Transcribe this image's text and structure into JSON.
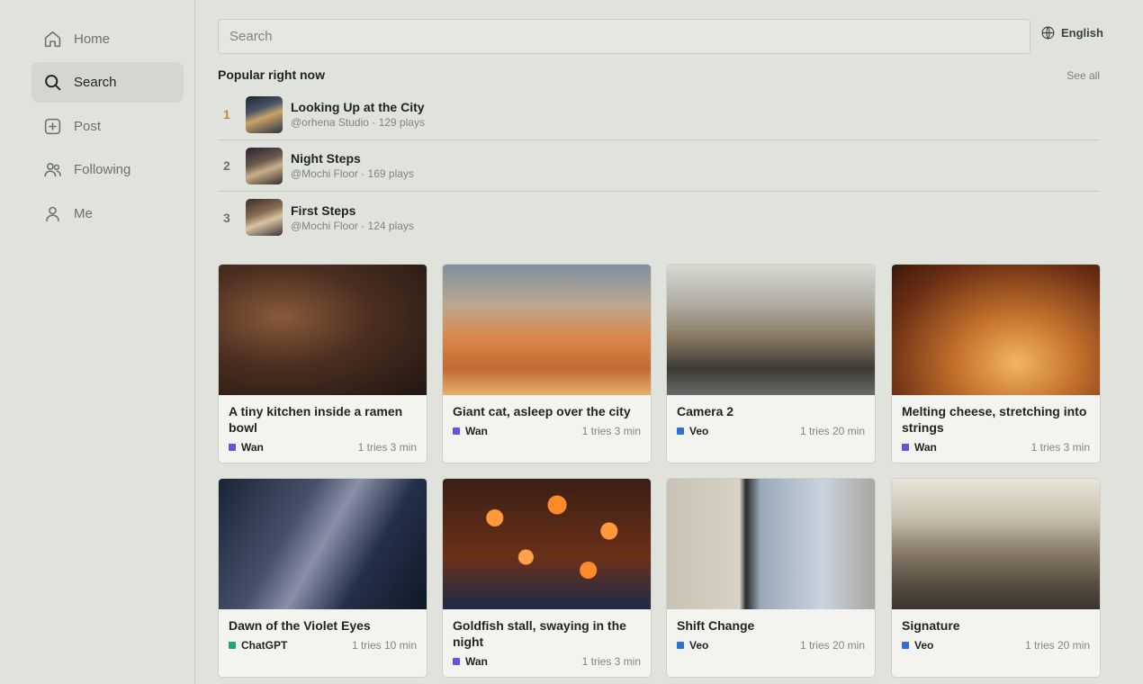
{
  "nav": [
    {
      "label": "Home",
      "icon": "home-icon",
      "active": false
    },
    {
      "label": "Search",
      "icon": "search-icon",
      "active": true
    },
    {
      "label": "Post",
      "icon": "plus-square-icon",
      "active": false
    },
    {
      "label": "Following",
      "icon": "users-icon",
      "active": false
    },
    {
      "label": "Me",
      "icon": "user-icon",
      "active": false
    }
  ],
  "search": {
    "placeholder": "Search",
    "value": ""
  },
  "language": {
    "label": "English",
    "icon": "globe-icon"
  },
  "popular": {
    "title": "Popular right now",
    "see_all": "See all",
    "items": [
      {
        "rank": "1",
        "title": "Looking Up at the City",
        "author": "@orhena Studio",
        "plays": "129 plays"
      },
      {
        "rank": "2",
        "title": "Night Steps",
        "author": "@Mochi Floor",
        "plays": "169 plays"
      },
      {
        "rank": "3",
        "title": "First Steps",
        "author": "@Mochi Floor",
        "plays": "124 plays"
      }
    ]
  },
  "cards": [
    {
      "title": "A tiny kitchen inside a ramen bowl",
      "model": "Wan",
      "model_color": "#6b4fe0",
      "meta": "1 tries 3 min"
    },
    {
      "title": "Giant cat, asleep over the city",
      "model": "Wan",
      "model_color": "#6b4fe0",
      "meta": "1 tries 3 min"
    },
    {
      "title": "Camera 2",
      "model": "Veo",
      "model_color": "#2f6fd6",
      "meta": "1 tries 20 min"
    },
    {
      "title": "Melting cheese, stretching into strings",
      "model": "Wan",
      "model_color": "#6b4fe0",
      "meta": "1 tries 3 min"
    },
    {
      "title": "Dawn of the Violet Eyes",
      "model": "ChatGPT",
      "model_color": "#1fa37a",
      "meta": "1 tries 10 min"
    },
    {
      "title": "Goldfish stall, swaying in the night",
      "model": "Wan",
      "model_color": "#6b4fe0",
      "meta": "1 tries 3 min"
    },
    {
      "title": "Shift Change",
      "model": "Veo",
      "model_color": "#2f6fd6",
      "meta": "1 tries 20 min"
    },
    {
      "title": "Signature",
      "model": "Veo",
      "model_color": "#2f6fd6",
      "meta": "1 tries 20 min"
    }
  ],
  "colors": {
    "accent_rank": "#c78a3a",
    "background": "#dfe3dc",
    "card": "#f3f4f0"
  }
}
